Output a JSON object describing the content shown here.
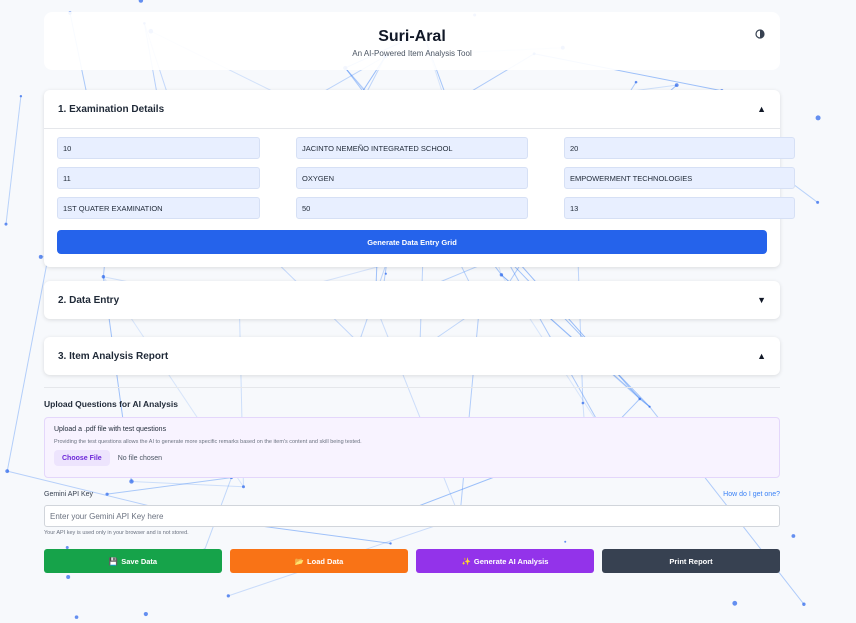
{
  "header": {
    "title": "Suri-Aral",
    "subtitle": "An AI-Powered Item Analysis Tool",
    "theme_icon": "contrast-icon"
  },
  "exam_details": {
    "heading": "1. Examination Details",
    "fields": [
      "10",
      "JACINTO NEMEÑO INTEGRATED SCHOOL",
      "20",
      "11",
      "OXYGEN",
      "EMPOWERMENT TECHNOLOGIES",
      "1ST QUATER EXAMINATION",
      "50",
      "13"
    ],
    "generate_button": "Generate Data Entry Grid"
  },
  "data_entry": {
    "heading": "2. Data Entry"
  },
  "report": {
    "heading": "3. Item Analysis Report"
  },
  "upload": {
    "heading": "Upload Questions for AI Analysis",
    "title": "Upload a .pdf file with test questions",
    "description": "Providing the test questions allows the AI to generate more specific remarks based on the item's content and skill being tested.",
    "choose_label": "Choose File",
    "file_status": "No file chosen"
  },
  "api": {
    "label": "Gemini API Key",
    "help_link": "How do I get one?",
    "placeholder": "Enter your Gemini API Key here",
    "value": "",
    "note": "Your API key is used only in your browser and is not stored."
  },
  "actions": {
    "save_icon": "💾",
    "save_label": "Save Data",
    "load_icon": "📂",
    "load_label": "Load Data",
    "ai_icon": "✨",
    "ai_label": "Generate AI Analysis",
    "print_label": "Print Report"
  },
  "chevrons": {
    "up": "▲",
    "down": "▼"
  },
  "colors": {
    "primary": "#2563eb",
    "save": "#16a34a",
    "load": "#f97316",
    "ai": "#9333ea",
    "print": "#374151"
  }
}
